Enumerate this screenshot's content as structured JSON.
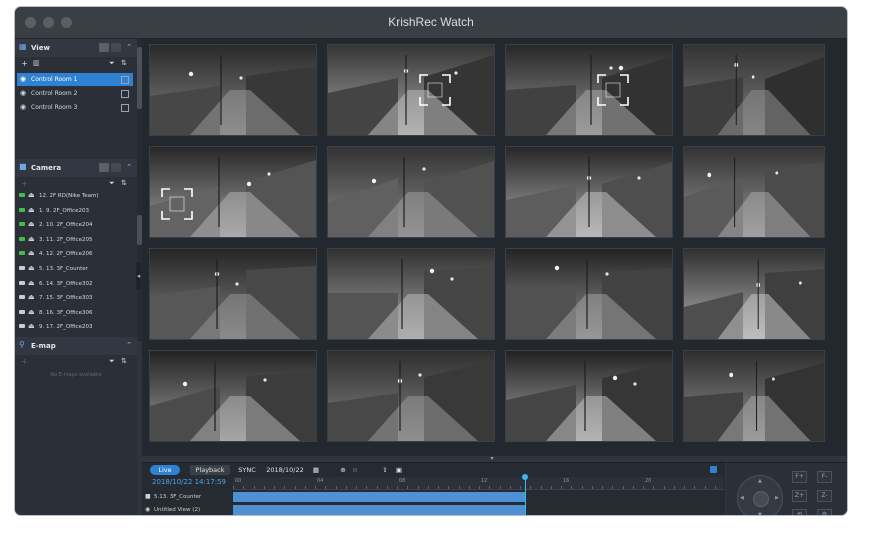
{
  "window": {
    "title": "KrishRec Watch"
  },
  "sidebar": {
    "view": {
      "title": "View",
      "add_label": "+",
      "items": [
        {
          "label": "Control Room 1",
          "selected": true
        },
        {
          "label": "Control Room 2",
          "selected": false
        },
        {
          "label": "Control Room 3",
          "selected": false
        }
      ]
    },
    "camera": {
      "title": "Camera",
      "items": [
        {
          "label": "12. 2F RD(Nike Team)",
          "status": "green"
        },
        {
          "label": "1. 9. 2F_Office203",
          "status": "green"
        },
        {
          "label": "2. 10. 2F_Office204",
          "status": "green"
        },
        {
          "label": "3. 11. 2F_Office205",
          "status": "green"
        },
        {
          "label": "4. 12. 2F_Office206",
          "status": "green"
        },
        {
          "label": "5. 13. 3F_Counter",
          "status": "gray"
        },
        {
          "label": "6. 14. 3F_Office302",
          "status": "gray"
        },
        {
          "label": "7. 15. 3F_Office303",
          "status": "gray"
        },
        {
          "label": "8. 16. 3F_Office306",
          "status": "gray"
        },
        {
          "label": "9. 17. 2F_Office203",
          "status": "gray"
        }
      ]
    },
    "emap": {
      "title": "E-map",
      "empty_text": "No E-maps available"
    }
  },
  "grid": {
    "tiles": [
      {
        "scene": "a",
        "face_box": false
      },
      {
        "scene": "b",
        "face_box": true
      },
      {
        "scene": "c",
        "face_box": true
      },
      {
        "scene": "d",
        "face_box": false
      },
      {
        "scene": "e",
        "face_box": true
      },
      {
        "scene": "f",
        "face_box": false
      },
      {
        "scene": "g",
        "face_box": false
      },
      {
        "scene": "h",
        "face_box": false
      },
      {
        "scene": "i",
        "face_box": false
      },
      {
        "scene": "j",
        "face_box": false
      },
      {
        "scene": "k",
        "face_box": false
      },
      {
        "scene": "l",
        "face_box": false
      },
      {
        "scene": "m",
        "face_box": false
      },
      {
        "scene": "n",
        "face_box": false
      },
      {
        "scene": "o",
        "face_box": false
      },
      {
        "scene": "p",
        "face_box": false
      }
    ]
  },
  "playback_bar": {
    "live_label": "Live",
    "playback_label": "Playback",
    "sync_label": "SYNC",
    "date": "2018/10/22",
    "timestamp": "2018/10/22 14:17:59",
    "ticks": [
      "00",
      "04",
      "08",
      "12",
      "16",
      "20"
    ],
    "tracks": [
      {
        "name": "5.13. 3F_Counter",
        "icon": "camera-icon"
      },
      {
        "name": "Untitled View (2)",
        "icon": "eye-icon"
      }
    ],
    "colors": {
      "accent": "#2f81d3",
      "cursor": "#39b7ef",
      "record_bar": "#4f8fd3"
    }
  },
  "ptz": {
    "buttons": [
      "F+",
      "F-",
      "Z+",
      "Z-",
      "⟲",
      "⚙"
    ]
  }
}
